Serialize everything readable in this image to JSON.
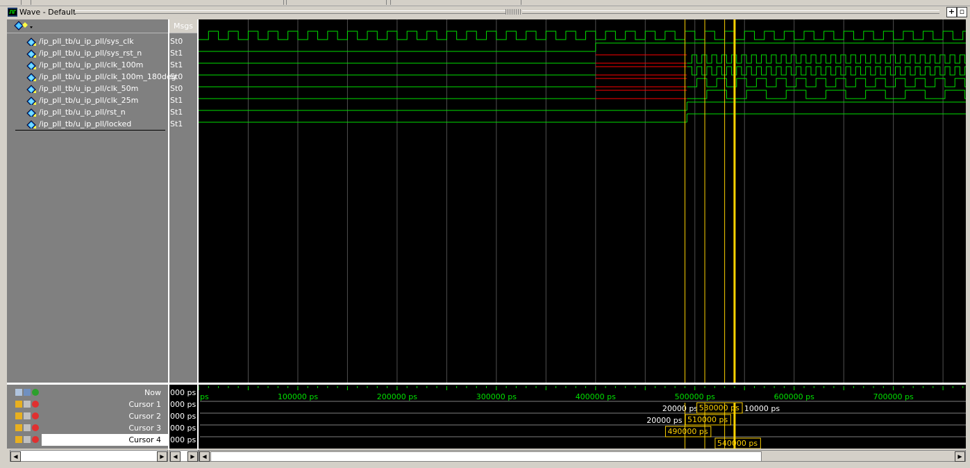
{
  "window": {
    "title": "Wave - Default",
    "add_button": "+",
    "undock_button": "▫"
  },
  "columns": {
    "messages_header": "Msgs"
  },
  "signals": [
    {
      "name": "/ip_pll_tb/u_ip_pll/sys_clk",
      "value": "St0"
    },
    {
      "name": "/ip_pll_tb/u_ip_pll/sys_rst_n",
      "value": "St1"
    },
    {
      "name": "/ip_pll_tb/u_ip_pll/clk_100m",
      "value": "St1"
    },
    {
      "name": "/ip_pll_tb/u_ip_pll/clk_100m_180deg",
      "value": "St0"
    },
    {
      "name": "/ip_pll_tb/u_ip_pll/clk_50m",
      "value": "St0"
    },
    {
      "name": "/ip_pll_tb/u_ip_pll/clk_25m",
      "value": "St1"
    },
    {
      "name": "/ip_pll_tb/u_ip_pll/rst_n",
      "value": "St1"
    },
    {
      "name": "/ip_pll_tb/u_ip_pll/locked",
      "value": "St1"
    }
  ],
  "cursors": [
    {
      "label": "Now",
      "value": "000 ps"
    },
    {
      "label": "Cursor 1",
      "value": "000 ps"
    },
    {
      "label": "Cursor 2",
      "value": "000 ps"
    },
    {
      "label": "Cursor 3",
      "value": "000 ps"
    },
    {
      "label": "Cursor 4",
      "value": "000 ps"
    }
  ],
  "timeline": {
    "start_fragment": "ps",
    "ticks": [
      "100000 ps",
      "200000 ps",
      "300000 ps",
      "400000 ps",
      "500000 ps",
      "600000 ps",
      "700000 ps"
    ],
    "tick_values_ps": [
      100000,
      200000,
      300000,
      400000,
      500000,
      600000,
      700000
    ],
    "view_start_ps": 0,
    "view_end_ps": 773000
  },
  "cursor_readouts": {
    "cursor1_delta_left": "20000 ps",
    "cursor1_time": "530000 ps",
    "cursor1_delta_right": "10000 ps",
    "cursor2_delta_left": "20000 ps",
    "cursor2_time": "510000 ps",
    "cursor3_time": "490000 ps",
    "cursor4_time": "540000 ps"
  },
  "colors": {
    "wave_green": "#00e000",
    "unknown_red": "#ff0000",
    "cursor_yellow": "#ffd200",
    "grid": "#505050",
    "background": "#000000"
  },
  "icons": [
    "wave-window-icon",
    "signal-diamond-icon",
    "lock-icon",
    "wrench-icon",
    "remove-cursor-icon",
    "add-cursor-icon"
  ]
}
